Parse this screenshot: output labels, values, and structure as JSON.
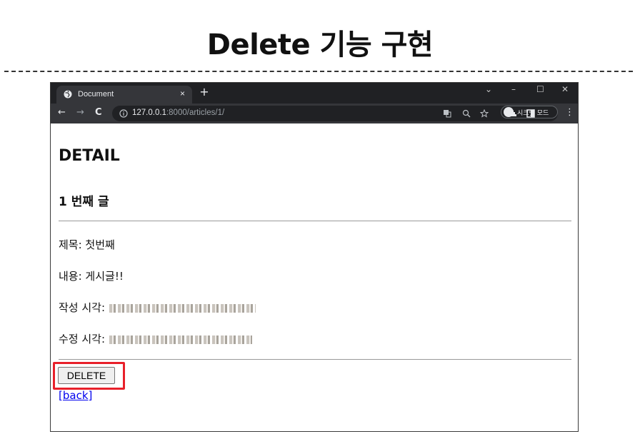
{
  "slide": {
    "title": "Delete 기능 구현"
  },
  "browser": {
    "tab": {
      "title": "Document",
      "close": "×"
    },
    "new_tab": "+",
    "window_controls": {
      "minimize": "–",
      "maximize": "☐",
      "close": "✕",
      "chevron": "⌄"
    },
    "nav": {
      "back": "←",
      "forward": "→",
      "reload": "C"
    },
    "url": {
      "host": "127.0.0.1",
      "path": ":8000/articles/1/"
    },
    "incognito_label": "시크릿 모드",
    "menu": "⋮"
  },
  "page": {
    "heading": "DETAIL",
    "subheading": "1 번째 글",
    "fields": [
      {
        "label": "제목: 첫번째"
      },
      {
        "label": "내용: 게시글!!"
      },
      {
        "label": "작성 시각:"
      },
      {
        "label": "수정 시각:"
      }
    ],
    "delete_button": "DELETE",
    "back_link": "[back]"
  },
  "colors": {
    "highlight": "#e8202a",
    "link": "#0000ee",
    "tabstrip": "#202124",
    "toolbar": "#35363a"
  }
}
